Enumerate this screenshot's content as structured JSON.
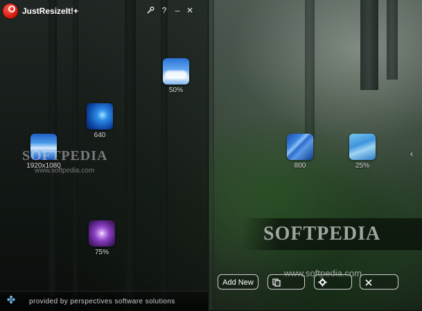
{
  "app": {
    "title": "JustResizeIt!+"
  },
  "titlebar": {
    "tools_icon": "wrench-icon",
    "help_label": "?",
    "minimize_label": "–",
    "close_label": "✕"
  },
  "presets": [
    {
      "id": "50pct",
      "label": "50%",
      "icon": "clouds-icon"
    },
    {
      "id": "640",
      "label": "640",
      "icon": "sparkle-icon"
    },
    {
      "id": "1920x1080",
      "label": "1920x1080",
      "icon": "blue-blur-icon"
    },
    {
      "id": "75pct",
      "label": "75%",
      "icon": "flower-icon"
    },
    {
      "id": "800",
      "label": "800",
      "icon": "stripes-icon"
    },
    {
      "id": "25pct",
      "label": "25%",
      "icon": "fog-icon"
    }
  ],
  "watermarks": {
    "brand": "SOFTPEDIA",
    "url": "www.softpedia.com"
  },
  "footer": {
    "text": "provided by perspectives software solutions"
  },
  "bottom_bar": {
    "add_new_label": "Add New",
    "copy_icon": "copy-icon",
    "settings_icon": "gear-icon",
    "remove_icon": "close-icon"
  },
  "side_arrow": {
    "label": "‹"
  }
}
